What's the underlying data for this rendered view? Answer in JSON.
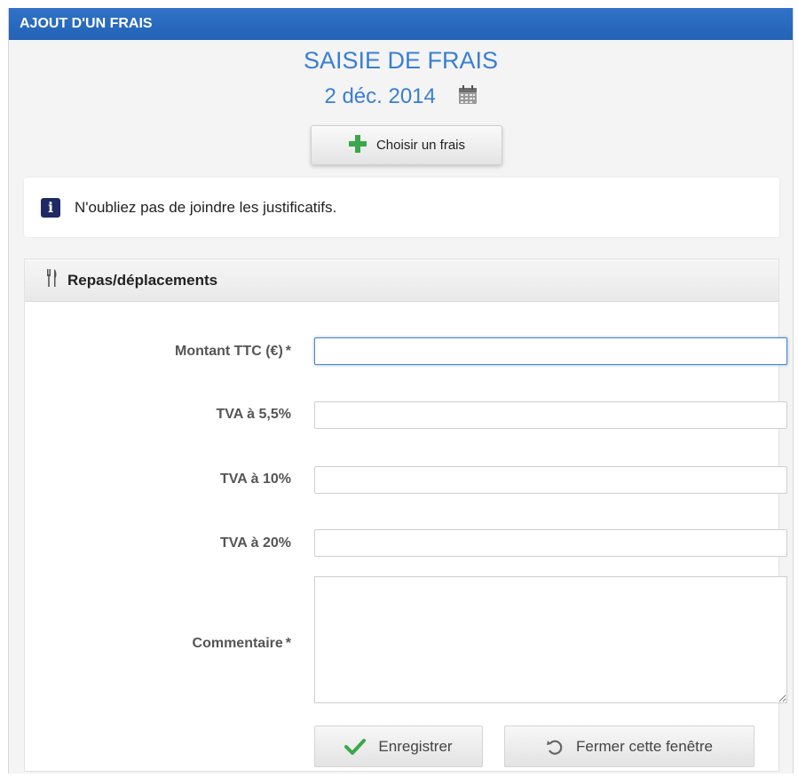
{
  "window": {
    "title": "AJOUT D'UN FRAIS"
  },
  "header": {
    "title": "SAISIE DE FRAIS",
    "date": "2 déc. 2014"
  },
  "choose_button": {
    "label": "Choisir un frais"
  },
  "info": {
    "message": "N'oubliez pas de joindre les justificatifs."
  },
  "section": {
    "title": "Repas/déplacements",
    "fields": {
      "montant": {
        "label": "Montant TTC (€)",
        "required": "*",
        "value": ""
      },
      "tva55": {
        "label": "TVA à 5,5%",
        "value": ""
      },
      "tva10": {
        "label": "TVA à 10%",
        "value": ""
      },
      "tva20": {
        "label": "TVA à 20%",
        "value": ""
      },
      "commentaire": {
        "label": "Commentaire",
        "required": "*",
        "value": ""
      }
    }
  },
  "buttons": {
    "save": "Enregistrer",
    "close": "Fermer cette fenêtre"
  },
  "colors": {
    "titlebar": "#2463b6",
    "heading": "#3a7fd0",
    "info_icon": "#1d2a63",
    "plus": "#3aa84a",
    "check": "#3aa84a"
  },
  "icons": {
    "calendar": "calendar-icon",
    "plus": "plus-icon",
    "info": "info-icon",
    "fork_knife": "fork-knife-icon",
    "check": "check-icon",
    "undo": "undo-icon"
  }
}
